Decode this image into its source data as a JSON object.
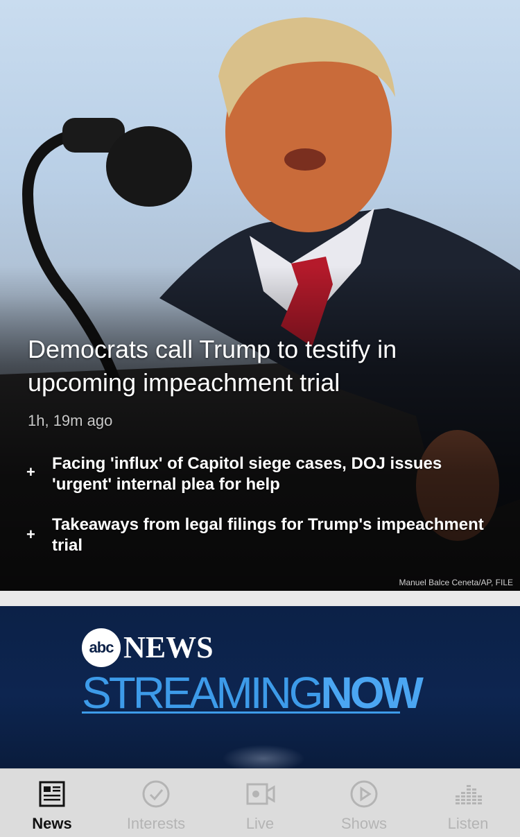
{
  "hero": {
    "headline": "Democrats call Trump to testify in upcoming impeachment trial",
    "timestamp": "1h, 19m ago",
    "related": [
      {
        "bullet": "+",
        "text": "Facing 'influx' of Capitol siege cases, DOJ issues 'urgent' internal plea for help"
      },
      {
        "bullet": "+",
        "text": "Takeaways from legal filings for Trump's impeachment trial"
      }
    ],
    "photo_credit": "Manuel Balce Ceneta/AP, FILE"
  },
  "banner": {
    "logo_abc": "abc",
    "logo_news": "NEWS",
    "streaming_thin": "STREAMING",
    "streaming_bold": "NOW"
  },
  "tabbar": {
    "tabs": [
      {
        "label": "News",
        "icon": "newspaper-icon",
        "active": true
      },
      {
        "label": "Interests",
        "icon": "checkmark-circle-icon",
        "active": false
      },
      {
        "label": "Live",
        "icon": "video-camera-icon",
        "active": false
      },
      {
        "label": "Shows",
        "icon": "play-circle-icon",
        "active": false
      },
      {
        "label": "Listen",
        "icon": "equalizer-icon",
        "active": false
      }
    ]
  },
  "colors": {
    "banner_bg": "#0c2147",
    "streaming_blue": "#3d9be9",
    "tab_active": "#111111",
    "tab_inactive": "#b4b4b4"
  }
}
